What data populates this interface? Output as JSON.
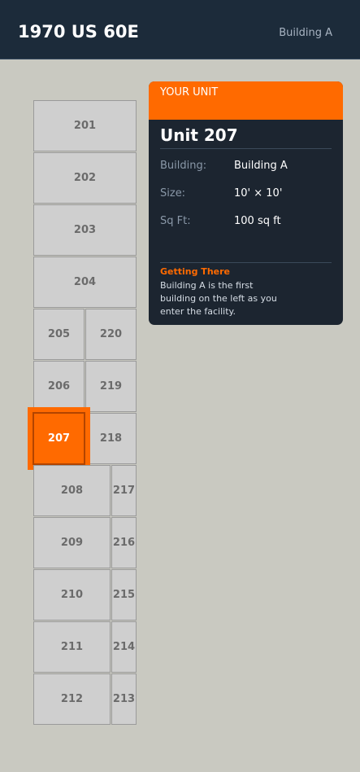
{
  "header": {
    "title": "1970 US 60E",
    "building_link": "Building A"
  },
  "map": {
    "units": [
      "201",
      "202",
      "203",
      "204",
      "205",
      "220",
      "206",
      "219",
      "207",
      "218",
      "208",
      "217",
      "209",
      "216",
      "210",
      "215",
      "211",
      "214",
      "212",
      "213"
    ],
    "selected_unit": "207"
  },
  "panel": {
    "banner_label": "YOUR UNIT",
    "unit_title": "Unit 207",
    "rows": [
      {
        "label": "Building:",
        "value": "Building A"
      },
      {
        "label": "Size:",
        "value": "10' × 10'"
      },
      {
        "label": "Sq Ft:",
        "value": "100 sq ft"
      }
    ],
    "directions_heading": "Getting There",
    "directions_text": "Building A is the first building on the left as you enter the facility."
  },
  "colors": {
    "header_bg": "#1c2b3a",
    "page_bg": "#c9c9c1",
    "accent": "#ff6a00",
    "panel_bg": "#1c2530",
    "unit_bg": "#cfcfcf"
  }
}
